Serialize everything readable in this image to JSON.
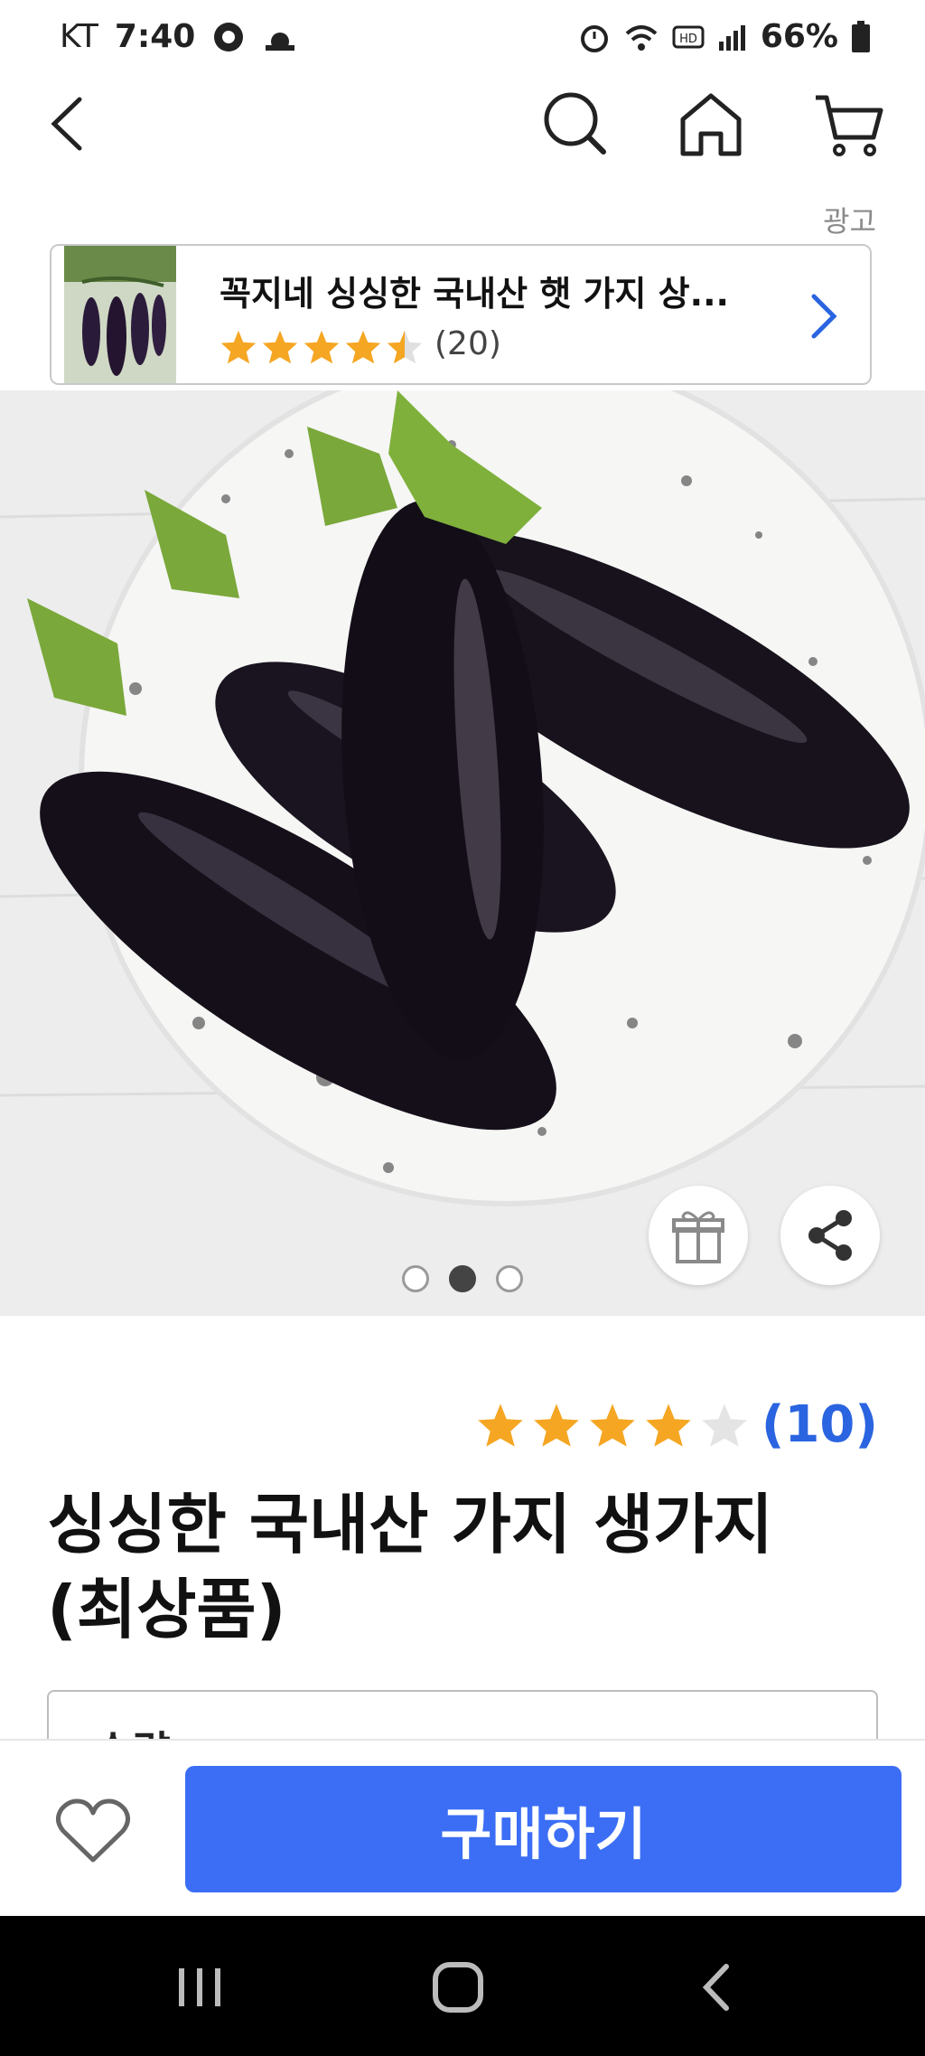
{
  "status_bar": {
    "carrier": "KT",
    "time": "7:40",
    "battery": "66%"
  },
  "nav": {
    "back_icon": "back-chevron-icon",
    "search_icon": "search-icon",
    "home_icon": "home-icon",
    "cart_icon": "cart-icon"
  },
  "ad": {
    "label": "광고",
    "title": "꼭지네 싱싱한 국내산 햇 가지 상...",
    "rating": 4.5,
    "review_count": "(20)"
  },
  "gallery": {
    "page_count": 3,
    "active_page": 2,
    "gift_icon": "gift-icon",
    "share_icon": "share-icon"
  },
  "product": {
    "rating": 4,
    "review_count": "(10)",
    "title_line1": "싱싱한 국내산 가지 생가지",
    "title_line2": "(최상품)",
    "quantity_label": "수량"
  },
  "action_bar": {
    "wishlist_icon": "heart-icon",
    "buy_label": "구매하기"
  },
  "colors": {
    "accent": "#3b6ef5",
    "star": "#f5a623",
    "link": "#2a64e0"
  }
}
